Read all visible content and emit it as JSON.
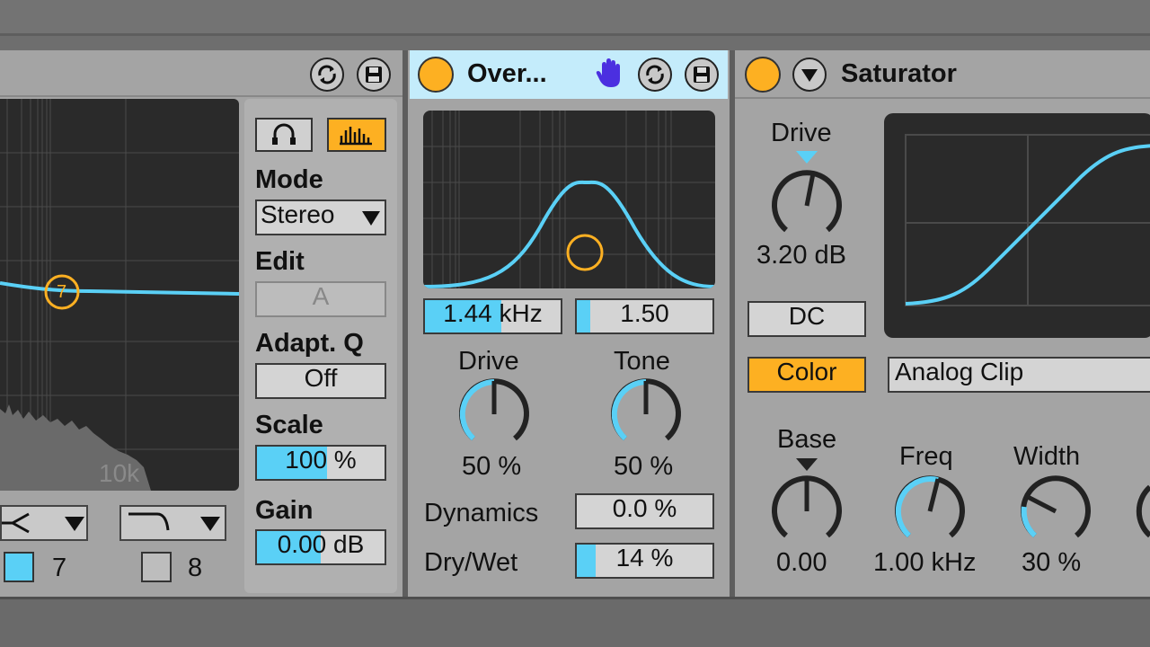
{
  "eq": {
    "freq_label": "10k",
    "band_point": "7",
    "filter_left_number": "7",
    "filter_right_number": "8",
    "mode_label": "Mode",
    "mode_value": "Stereo",
    "edit_label": "Edit",
    "edit_value": "A",
    "adaptq_label": "Adapt. Q",
    "adaptq_value": "Off",
    "scale_label": "Scale",
    "scale_value": "100 %",
    "scale_fraction": 0.55,
    "gain_label": "Gain",
    "gain_value": "0.00 dB",
    "gain_fraction": 0.5
  },
  "overdrive": {
    "title": "Over...",
    "freq_value": "1.44 kHz",
    "freq_fraction": 0.56,
    "width_value": "1.50",
    "width_fraction": 0.1,
    "drive_label": "Drive",
    "drive_value": "50 %",
    "tone_label": "Tone",
    "tone_value": "50 %",
    "dynamics_label": "Dynamics",
    "dynamics_value": "0.0 %",
    "drywet_label": "Dry/Wet",
    "drywet_value": "14 %",
    "drywet_fraction": 0.14
  },
  "saturator": {
    "title": "Saturator",
    "drive_label": "Drive",
    "drive_value": "3.20 dB",
    "dc_label": "DC",
    "color_label": "Color",
    "curve_type": "Analog Clip",
    "base_label": "Base",
    "base_value": "0.00",
    "freq_label": "Freq",
    "freq_value": "1.00 kHz",
    "width_label": "Width",
    "width_value": "30 %"
  },
  "icons": [
    "hot-swap-icon",
    "save-icon",
    "hand-icon",
    "dropdown-arrow-icon",
    "headphone-icon",
    "spectrum-icon"
  ],
  "colors": {
    "accent_blue": "#5ad0f6",
    "accent_orange": "#fdb022",
    "panel": "#a4a4a4",
    "display": "#2a2a2a"
  }
}
